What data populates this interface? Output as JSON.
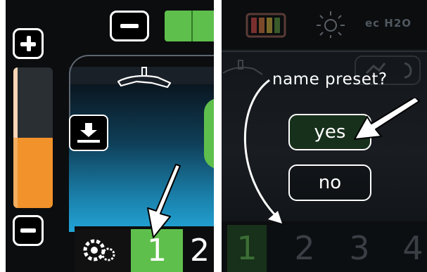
{
  "colors": {
    "accent_green": "#5fbf4c",
    "accent_orange": "#f2922a",
    "background": "#0b0d0f",
    "water_blue": "#22a4d6",
    "text": "#ffffff"
  },
  "left_panel": {
    "buttons": {
      "plus_icon": "plus-icon",
      "minus_icon": "minus-icon",
      "top_minus_icon": "minus-icon",
      "store_icon": "download-icon"
    },
    "gauge": {
      "level_fraction": 0.5
    },
    "tabs": [
      {
        "label": "1",
        "active": true
      },
      {
        "label": "2",
        "active": false
      }
    ],
    "gear_icon": "gears-icon"
  },
  "right_panel": {
    "status_icons": [
      "battery-icon",
      "sun-icon",
      "ec-h2o-icon"
    ],
    "status_text": "ec H2O",
    "dialog": {
      "title": "name preset?",
      "yes_label": "yes",
      "no_label": "no"
    },
    "presets": [
      "1",
      "2",
      "3",
      "4"
    ],
    "active_preset": "1"
  }
}
